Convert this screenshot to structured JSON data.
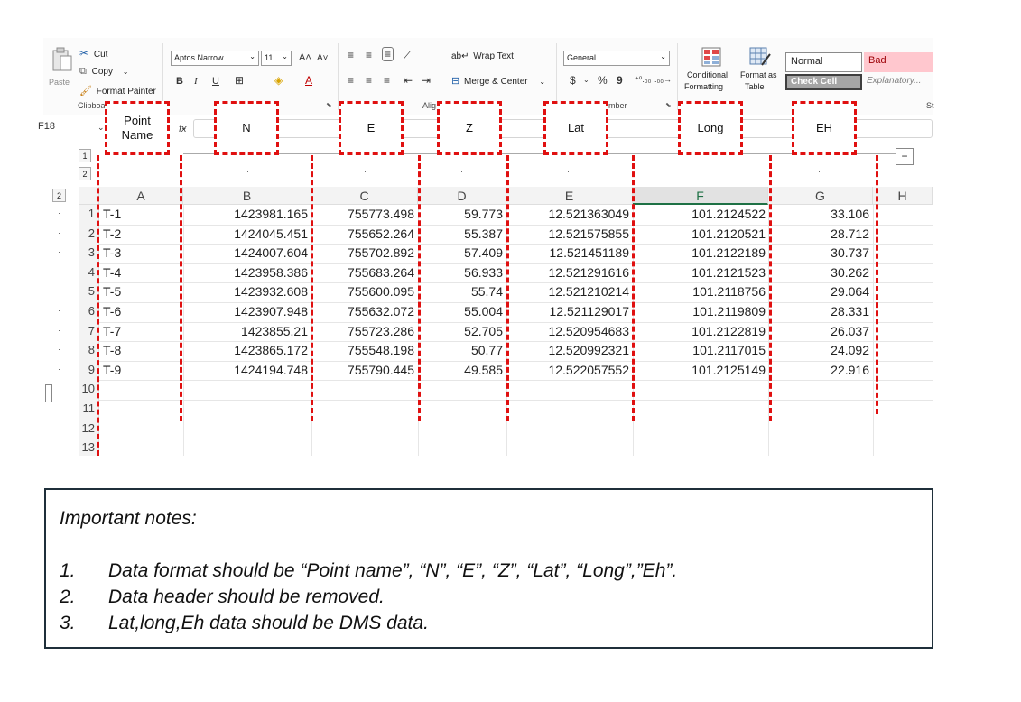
{
  "ribbon": {
    "clipboard": {
      "paste": "Paste",
      "cut": "Cut",
      "copy": "Copy",
      "format_painter": "Format Painter",
      "group_label": "Clipboa"
    },
    "font": {
      "family": "Aptos Narrow",
      "size": "11",
      "bold": "B",
      "italic": "I",
      "underline": "U"
    },
    "alignment": {
      "wrap_text": "Wrap Text",
      "merge_center": "Merge & Center",
      "group_label": "Alig"
    },
    "number": {
      "format": "General",
      "dollar": "$",
      "percent": "%",
      "comma": "9",
      "group_label": "mber"
    },
    "styles": {
      "conditional_formatting": [
        "Conditional",
        "Formatting"
      ],
      "format_as_table": [
        "Format as",
        "Table"
      ],
      "normal": "Normal",
      "bad": "Bad",
      "check_cell": "Check Cell",
      "explanatory": "Explanatory...",
      "group_label_right": "St"
    }
  },
  "formula_bar": {
    "name_box": "F18",
    "fx": "fx"
  },
  "outline_levels": [
    "1",
    "2"
  ],
  "outline_left_level": "2",
  "column_headers": [
    "A",
    "B",
    "C",
    "D",
    "E",
    "F",
    "G",
    "H"
  ],
  "selected_column": "F",
  "row_numbers": [
    "1",
    "2",
    "3",
    "4",
    "5",
    "6",
    "7",
    "8",
    "9",
    "10",
    "11",
    "12",
    "13"
  ],
  "rows": [
    {
      "point": "T-1",
      "n": "1423981.165",
      "e": "755773.498",
      "z": "59.773",
      "lat": "12.521363049",
      "long": "101.2124522",
      "eh": "33.106"
    },
    {
      "point": "T-2",
      "n": "1424045.451",
      "e": "755652.264",
      "z": "55.387",
      "lat": "12.521575855",
      "long": "101.2120521",
      "eh": "28.712"
    },
    {
      "point": "T-3",
      "n": "1424007.604",
      "e": "755702.892",
      "z": "57.409",
      "lat": "12.521451189",
      "long": "101.2122189",
      "eh": "30.737"
    },
    {
      "point": "T-4",
      "n": "1423958.386",
      "e": "755683.264",
      "z": "56.933",
      "lat": "12.521291616",
      "long": "101.2121523",
      "eh": "30.262"
    },
    {
      "point": "T-5",
      "n": "1423932.608",
      "e": "755600.095",
      "z": "55.74",
      "lat": "12.521210214",
      "long": "101.2118756",
      "eh": "29.064"
    },
    {
      "point": "T-6",
      "n": "1423907.948",
      "e": "755632.072",
      "z": "55.004",
      "lat": "12.521129017",
      "long": "101.2119809",
      "eh": "28.331"
    },
    {
      "point": "T-7",
      "n": "1423855.21",
      "e": "755723.286",
      "z": "52.705",
      "lat": "12.520954683",
      "long": "101.2122819",
      "eh": "26.037"
    },
    {
      "point": "T-8",
      "n": "1423865.172",
      "e": "755548.198",
      "z": "50.77",
      "lat": "12.520992321",
      "long": "101.2117015",
      "eh": "24.092"
    },
    {
      "point": "T-9",
      "n": "1424194.748",
      "e": "755790.445",
      "z": "49.585",
      "lat": "12.522057552",
      "long": "101.2125149",
      "eh": "22.916"
    }
  ],
  "annotation_labels": {
    "point_name": [
      "Point",
      "Name"
    ],
    "n": "N",
    "e": "E",
    "z": "Z",
    "lat": "Lat",
    "long": "Long",
    "eh": "EH"
  },
  "notes": {
    "title": "Important notes:",
    "items": [
      {
        "num": "1.",
        "text": "Data format should be “Point name”, “N”, “E”, “Z”, “Lat”, “Long”,”Eh”."
      },
      {
        "num": "2.",
        "text": "Data header should be removed."
      },
      {
        "num": "3.",
        "text": "Lat,long,Eh data should be DMS data."
      }
    ]
  },
  "colors": {
    "annotation_red": "#e01010",
    "selected_column_green": "#1e7145",
    "bad_style_bg": "#ffc7ce",
    "bad_style_text": "#9c0006",
    "check_cell_bg": "#a5a5a5",
    "notes_border": "#1f2f3a"
  }
}
